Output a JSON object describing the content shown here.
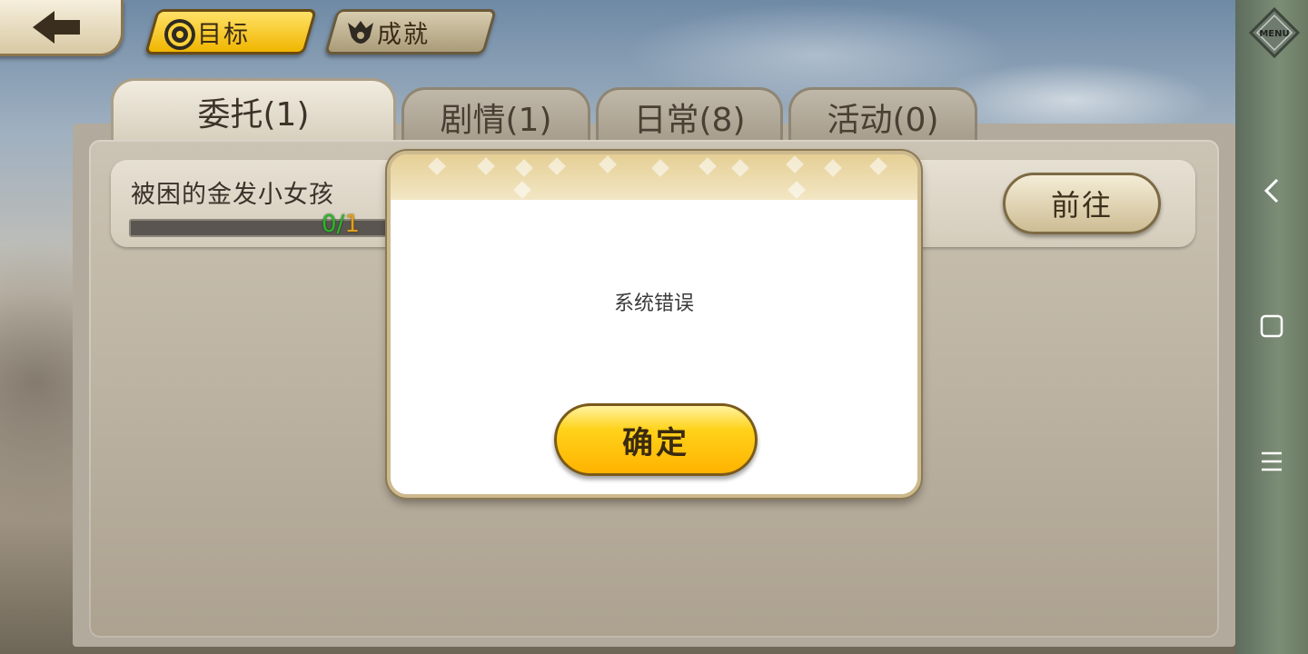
{
  "top_nav": {
    "goal_tab_label": "目标",
    "achievement_tab_label": "成就",
    "menu_label": "MENU"
  },
  "category_tabs": [
    {
      "label": "委托(1)",
      "active": true
    },
    {
      "label": "剧情(1)",
      "active": false
    },
    {
      "label": "日常(8)",
      "active": false
    },
    {
      "label": "活动(0)",
      "active": false
    }
  ],
  "quest": {
    "title": "被困的金发小女孩",
    "progress_current": "0",
    "progress_separator": "/",
    "progress_total": "1",
    "progress_fraction": 0,
    "go_button_label": "前往"
  },
  "dialog": {
    "message": "系统错误",
    "confirm_label": "确定"
  },
  "colors": {
    "accent_gold": "#ffc21a",
    "progress_done": "#2db52d",
    "progress_total": "#e0a020"
  }
}
